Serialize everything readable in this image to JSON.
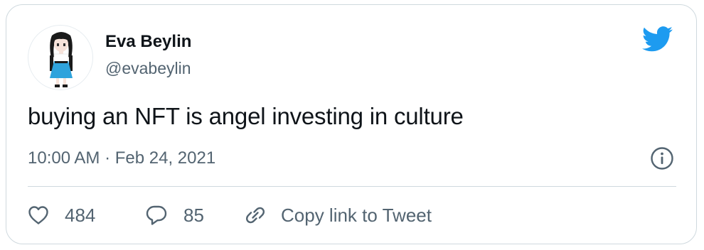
{
  "tweet": {
    "author": {
      "name": "Eva Beylin",
      "handle": "@evabeylin",
      "avatar_icon": "anime-character-avatar"
    },
    "brand_icon": "twitter-bird-icon",
    "brand_color": "#1d9bf0",
    "text": "buying an NFT is angel investing in culture",
    "timestamp": "10:00 AM · Feb 24, 2021",
    "info_icon": "info-icon",
    "actions": {
      "like_count": "484",
      "reply_count": "85",
      "copy_label": "Copy link to Tweet"
    }
  }
}
